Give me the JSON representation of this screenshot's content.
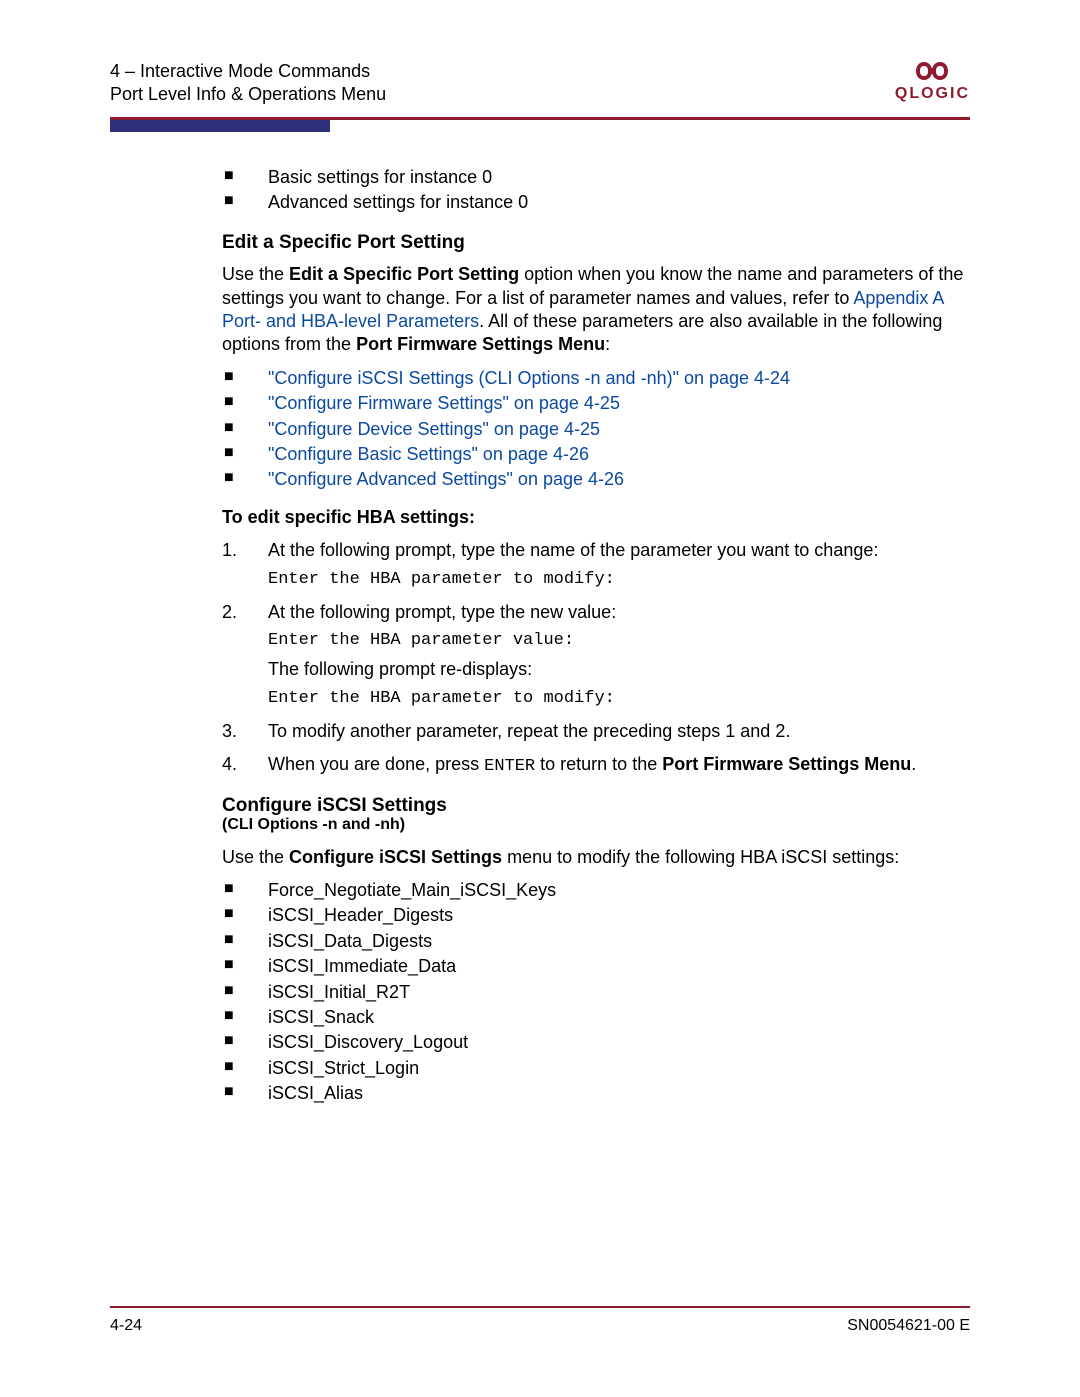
{
  "header": {
    "line1": "4 – Interactive Mode Commands",
    "line2": "Port Level Info & Operations Menu",
    "logo_text": "QLOGIC"
  },
  "intro_bullets": [
    "Basic settings for instance 0",
    "Advanced settings for instance 0"
  ],
  "section1": {
    "title": "Edit a Specific Port Setting",
    "para_parts": {
      "p1a": "Use the ",
      "p1b": "Edit a Specific Port Setting",
      "p1c": " option when you know the name and parameters of the settings you want to change. For a list of parameter names and values, refer to ",
      "p1_link": "Appendix A Port- and HBA-level Parameters",
      "p1d": ". All of these parameters are also available in the following options from the ",
      "p1e": "Port Firmware Settings Menu",
      "p1f": ":"
    },
    "link_bullets": [
      "\"Configure iSCSI Settings (CLI Options -n and -nh)\" on page 4-24",
      "\"Configure Firmware Settings\" on page 4-25",
      "\"Configure Device Settings\" on page 4-25",
      "\"Configure Basic Settings\" on page 4-26",
      "\"Configure Advanced Settings\" on page 4-26"
    ],
    "instr_heading": "To edit specific HBA settings:",
    "steps": {
      "s1": {
        "num": "1.",
        "text": "At the following prompt, type the name of the parameter you want to change:",
        "code": "Enter the HBA parameter to modify:"
      },
      "s2": {
        "num": "2.",
        "text": "At the following prompt, type the new value:",
        "code1": "Enter the HBA parameter value:",
        "mid": "The following prompt re-displays:",
        "code2": "Enter the HBA parameter to modify:"
      },
      "s3": {
        "num": "3.",
        "text": "To modify another parameter, repeat the preceding steps 1 and 2."
      },
      "s4": {
        "num": "4.",
        "a": "When you are done, press ",
        "enter": "ENTER",
        "b": " to return to the ",
        "bold": "Port Firmware Settings Menu",
        "c": "."
      }
    }
  },
  "section2": {
    "title": "Configure iSCSI Settings",
    "sub": "(CLI Options -n and -nh)",
    "para": {
      "a": "Use the ",
      "b": "Configure iSCSI Settings",
      "c": " menu to modify the following HBA iSCSI settings:"
    },
    "bullets": [
      "Force_Negotiate_Main_iSCSI_Keys",
      "iSCSI_Header_Digests",
      "iSCSI_Data_Digests",
      "iSCSI_Immediate_Data",
      "iSCSI_Initial_R2T",
      "iSCSI_Snack",
      "iSCSI_Discovery_Logout",
      "iSCSI_Strict_Login",
      "iSCSI_Alias"
    ]
  },
  "footer": {
    "left": "4-24",
    "right": "SN0054621-00  E"
  }
}
